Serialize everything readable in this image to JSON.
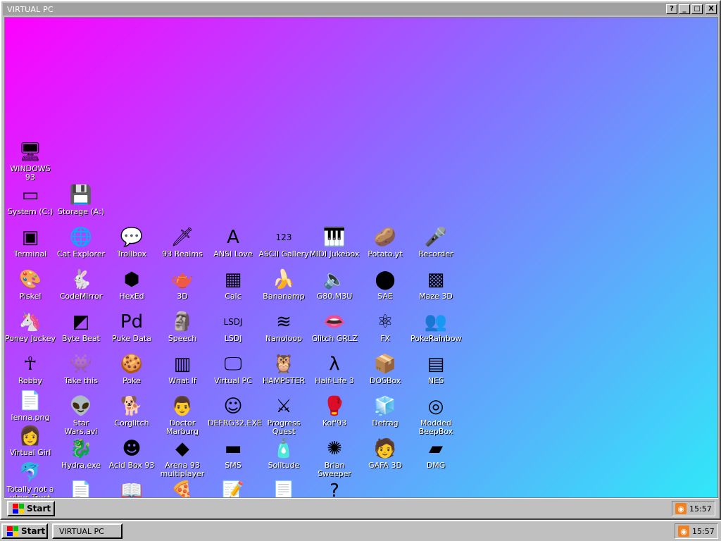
{
  "window": {
    "title": "VIRTUAL PC",
    "buttons": {
      "help": "?",
      "minimize": "_",
      "maximize": "□",
      "close": "X"
    }
  },
  "desktop": {
    "icons": [
      {
        "label": "WINDOWS 93",
        "glyph": "🖥",
        "name": "windows93-icon"
      },
      {
        "label": "System (C:)",
        "glyph": "▭",
        "name": "system-drive-icon"
      },
      {
        "label": "Storage (A:)",
        "glyph": "💾",
        "name": "storage-drive-icon"
      },
      {
        "label": "Terminal",
        "glyph": "▣",
        "name": "terminal-icon"
      },
      {
        "label": "Cat Explorer",
        "glyph": "🌐",
        "name": "cat-explorer-icon"
      },
      {
        "label": "Trollbox",
        "glyph": "💬",
        "name": "trollbox-icon"
      },
      {
        "label": "93 Realms",
        "glyph": "🗡",
        "name": "93-realms-icon"
      },
      {
        "label": "ANSI Love",
        "glyph": "A",
        "name": "ansi-love-icon"
      },
      {
        "label": "ASCII Gallery",
        "glyph": "123",
        "name": "ascii-gallery-icon"
      },
      {
        "label": "MIDI Jukebox",
        "glyph": "🎹",
        "name": "midi-jukebox-icon"
      },
      {
        "label": "Potato.yt",
        "glyph": "🥔",
        "name": "potato-icon"
      },
      {
        "label": "Recorder",
        "glyph": "🎤",
        "name": "recorder-icon"
      },
      {
        "label": "Piskel",
        "glyph": "🎨",
        "name": "piskel-icon"
      },
      {
        "label": "CodeMirror",
        "glyph": "🐇",
        "name": "codemirror-icon"
      },
      {
        "label": "HexEd",
        "glyph": "⬢",
        "name": "hexed-icon"
      },
      {
        "label": "3D",
        "glyph": "🫖",
        "name": "3d-icon"
      },
      {
        "label": "Calc",
        "glyph": "▦",
        "name": "calc-icon"
      },
      {
        "label": "Bananamp",
        "glyph": "🍌",
        "name": "bananamp-icon"
      },
      {
        "label": "G80.M3U",
        "glyph": "🔈",
        "name": "g80-m3u-icon"
      },
      {
        "label": "SAE",
        "glyph": "⬤",
        "name": "sae-icon"
      },
      {
        "label": "Maze 3D",
        "glyph": "▩",
        "name": "maze-3d-icon"
      },
      {
        "label": "Poney Jockey",
        "glyph": "🦄",
        "name": "poney-jockey-icon"
      },
      {
        "label": "Byte Beat",
        "glyph": "◩",
        "name": "byte-beat-icon"
      },
      {
        "label": "Puke Data",
        "glyph": "Pd",
        "name": "puke-data-icon"
      },
      {
        "label": "Speech",
        "glyph": "🗿",
        "name": "speech-icon"
      },
      {
        "label": "LSDJ",
        "glyph": "LSDJ",
        "name": "lsdj-icon"
      },
      {
        "label": "Nanoloop",
        "glyph": "≋",
        "name": "nanoloop-icon"
      },
      {
        "label": "Glitch GRLZ",
        "glyph": "👄",
        "name": "glitch-grlz-icon"
      },
      {
        "label": "FX",
        "glyph": "⚛",
        "name": "fx-icon"
      },
      {
        "label": "PokeRainbow",
        "glyph": "👥",
        "name": "pokerainbow-icon"
      },
      {
        "label": "Robby",
        "glyph": "☥",
        "name": "robby-icon"
      },
      {
        "label": "Take this",
        "glyph": "👾",
        "name": "take-this-icon"
      },
      {
        "label": "Poke",
        "glyph": "🍪",
        "name": "poke-icon"
      },
      {
        "label": "What If",
        "glyph": "▥",
        "name": "what-if-icon"
      },
      {
        "label": "Virtual PC",
        "glyph": "🖵",
        "name": "virtual-pc-icon"
      },
      {
        "label": "HAMPSTER",
        "glyph": "🦉",
        "name": "hampster-icon"
      },
      {
        "label": "Half-Life 3",
        "glyph": "λ",
        "name": "half-life-3-icon"
      },
      {
        "label": "DOSBox",
        "glyph": "📦",
        "name": "dosbox-icon"
      },
      {
        "label": "NES",
        "glyph": "▤",
        "name": "nes-icon"
      },
      {
        "label": "lenna.png",
        "glyph": "📄",
        "name": "lenna-png-icon"
      },
      {
        "label": "Star Wars.avi",
        "glyph": "👽",
        "name": "star-wars-avi-icon"
      },
      {
        "label": "Corglitch",
        "glyph": "🐕",
        "name": "corglitch-icon"
      },
      {
        "label": "Doctor Marburg",
        "glyph": "👨",
        "name": "doctor-marburg-icon"
      },
      {
        "label": "DEFRG32.EXE",
        "glyph": "☺",
        "name": "defrg32-icon"
      },
      {
        "label": "Progress Quest",
        "glyph": "⚔",
        "name": "progress-quest-icon"
      },
      {
        "label": "Kof'93",
        "glyph": "🥊",
        "name": "kof93-icon"
      },
      {
        "label": "Defrag",
        "glyph": "🧊",
        "name": "defrag-icon"
      },
      {
        "label": "Modded BeepBox",
        "glyph": "◎",
        "name": "modded-beepbox-icon"
      },
      {
        "label": "Virtual Girl",
        "glyph": "👩",
        "name": "virtual-girl-icon"
      },
      {
        "label": "Hydra.exe",
        "glyph": "🐉",
        "name": "hydra-exe-icon"
      },
      {
        "label": "Acid Box 93",
        "glyph": "☻",
        "name": "acid-box-93-icon"
      },
      {
        "label": "Arena 93 multiplayer",
        "glyph": "◆",
        "name": "arena-93-icon"
      },
      {
        "label": "SMS",
        "glyph": "▬",
        "name": "sms-icon"
      },
      {
        "label": "Solitude",
        "glyph": "🧴",
        "name": "solitude-icon"
      },
      {
        "label": "Brian Sweeper",
        "glyph": "✺",
        "name": "brian-sweeper-icon"
      },
      {
        "label": "GAFA 3D",
        "glyph": "🧑",
        "name": "gafa-3d-icon"
      },
      {
        "label": "DMG",
        "glyph": "▰",
        "name": "dmg-icon"
      },
      {
        "label": "Totally not a virus.Trust",
        "glyph": "🐬",
        "name": "totally-not-a-virus-icon"
      },
      {
        "label": "",
        "glyph": "📄",
        "name": "doc-red-icon"
      },
      {
        "label": "",
        "glyph": "📖",
        "name": "book-icon"
      },
      {
        "label": "",
        "glyph": "🍕",
        "name": "pizza-icon"
      },
      {
        "label": "",
        "glyph": "📝",
        "name": "notepad-icon"
      },
      {
        "label": "",
        "glyph": "📃",
        "name": "text-file-icon"
      },
      {
        "label": "",
        "glyph": "?",
        "name": "help-icon"
      }
    ]
  },
  "inner_taskbar": {
    "start_label": "Start",
    "clock": "15:57"
  },
  "outer_taskbar": {
    "start_label": "Start",
    "task_label": "VIRTUAL PC",
    "clock": "15:57"
  },
  "colors": {
    "gradient_start": "#ff00ff",
    "gradient_end": "#30e8f8",
    "chrome": "#c0c0c0"
  }
}
